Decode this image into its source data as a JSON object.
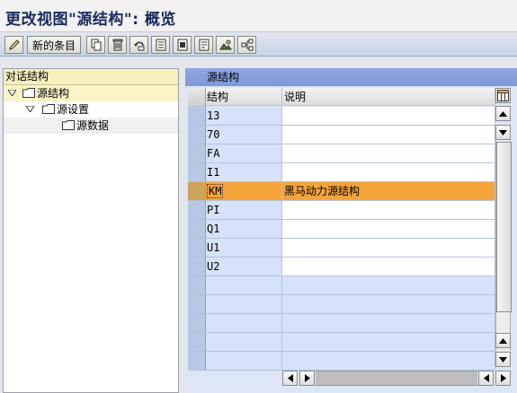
{
  "window": {
    "title": "更改视图\"源结构\": 概览"
  },
  "toolbar": {
    "new_entries_label": "新的条目",
    "buttons": [
      "edit-icon",
      "copy-icon",
      "delete-icon",
      "undo-icon",
      "select-all-icon",
      "select-block-icon",
      "deselect-all-icon",
      "image-icon",
      "hierarchy-icon"
    ]
  },
  "left_panel": {
    "header": "对话结构",
    "tree": [
      {
        "label": "源结构",
        "level": 0,
        "expanded": true,
        "selected": true
      },
      {
        "label": "源设置",
        "level": 1,
        "expanded": true
      },
      {
        "label": "源数据",
        "level": 2
      }
    ]
  },
  "right_panel": {
    "header": "源结构",
    "columns": [
      "结构",
      "说明"
    ],
    "rows": [
      {
        "key": "13",
        "desc": ""
      },
      {
        "key": "70",
        "desc": ""
      },
      {
        "key": "FA",
        "desc": ""
      },
      {
        "key": "I1",
        "desc": ""
      },
      {
        "key": "KM",
        "desc": "黑马动力源结构",
        "highlighted": true
      },
      {
        "key": "PI",
        "desc": ""
      },
      {
        "key": "Q1",
        "desc": ""
      },
      {
        "key": "U1",
        "desc": ""
      },
      {
        "key": "U2",
        "desc": ""
      }
    ],
    "empty_rows": 5
  },
  "colors": {
    "header_blue": "#8fa7e2",
    "highlight_orange": "#f5a43a",
    "key_column": "#d6e2f7",
    "tree_header": "#f6f0c0"
  }
}
